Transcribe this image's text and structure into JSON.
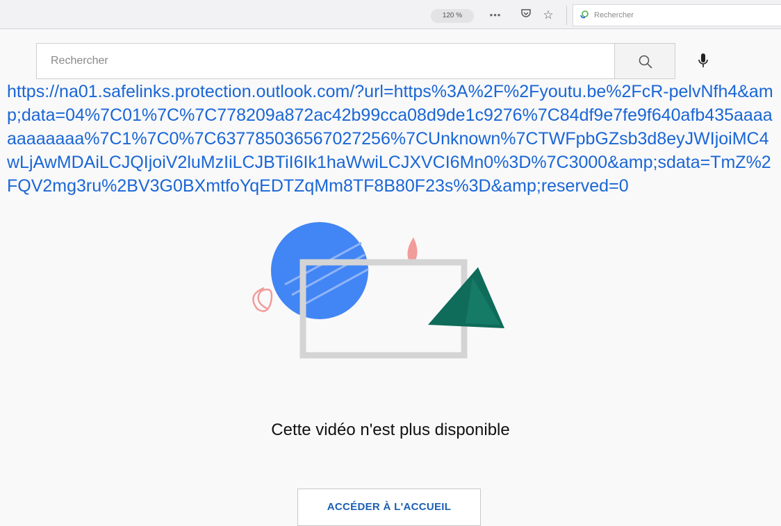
{
  "browser_toolbar": {
    "zoom_level": "120 %",
    "page_actions_icon": "ellipsis-icon",
    "pocket_icon": "pocket-icon",
    "bookmark_icon": "star-icon",
    "search_placeholder": "Rechercher"
  },
  "youtube_header": {
    "search_placeholder": "Rechercher",
    "search_button_icon": "search-icon",
    "voice_search_icon": "microphone-icon"
  },
  "safelink_url": "https://na01.safelinks.protection.outlook.com/?url=https%3A%2F%2Fyoutu.be%2FcR-pelvNfh4&amp;data=04%7C01%7C%7C778209a872ac42b99cca08d9de1c9276%7C84df9e7fe9f640afb435aaaaaaaaaaaa%7C1%7C0%7C637785036567027256%7CUnknown%7CTWFpbGZsb3d8eyJWIjoiMC4wLjAwMDAiLCJQIjoiV2luMzIiLCJBTiI6Ik1haWwiLCJXVCI6Mn0%3D%7C3000&amp;sdata=TmZ%2FQV2mg3ru%2BV3G0BXmtfoYqEDTZqMm8TF8B80F23s%3D&amp;reserved=0",
  "main": {
    "message": "Cette vidéo n'est plus disponible",
    "home_button_label": "ACCÉDER À L'ACCUEIL"
  },
  "colors": {
    "link": "#1a66d6",
    "button_text": "#1a5fb4",
    "illustration_blue": "#4285f4",
    "illustration_green": "#0f6b5a",
    "illustration_pink": "#f29b9b"
  }
}
